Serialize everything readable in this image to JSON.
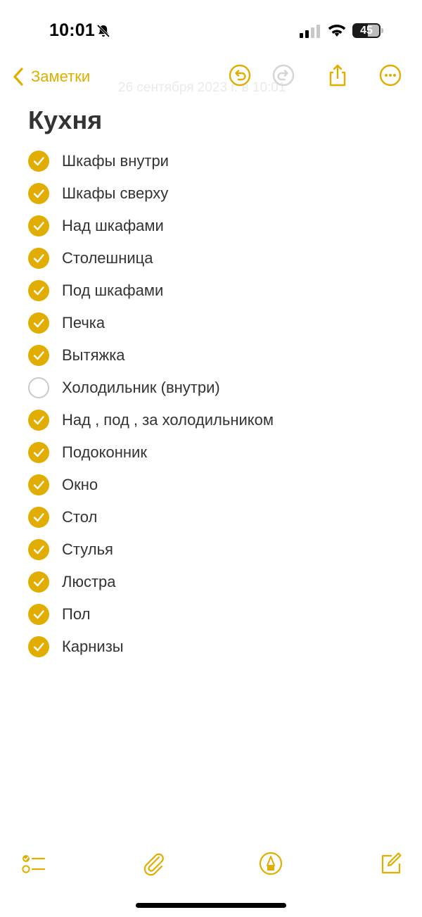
{
  "status_bar": {
    "time": "10:01",
    "battery": "45",
    "icons": [
      "bell-slash-icon",
      "cellular-signal-icon",
      "wifi-icon",
      "battery-icon"
    ]
  },
  "nav": {
    "back_label": "Заметки",
    "faded_date": "26 сентября 2023 г. в 10:01",
    "icons": [
      "chevron-left-icon",
      "undo-icon",
      "redo-icon",
      "share-icon",
      "more-icon"
    ]
  },
  "note": {
    "title": "Кухня",
    "items": [
      {
        "label": "Шкафы внутри",
        "checked": true
      },
      {
        "label": "Шкафы сверху",
        "checked": true
      },
      {
        "label": "Над шкафами",
        "checked": true
      },
      {
        "label": "Столешница",
        "checked": true
      },
      {
        "label": "Под шкафами",
        "checked": true
      },
      {
        "label": "Печка",
        "checked": true
      },
      {
        "label": "Вытяжка",
        "checked": true
      },
      {
        "label": "Холодильник (внутри)",
        "checked": false
      },
      {
        "label": "Над , под , за холодильником",
        "checked": true
      },
      {
        "label": "Подоконник",
        "checked": true
      },
      {
        "label": "Окно",
        "checked": true
      },
      {
        "label": "Стол",
        "checked": true
      },
      {
        "label": "Стулья",
        "checked": true
      },
      {
        "label": "Люстра",
        "checked": true
      },
      {
        "label": "Пол",
        "checked": true
      },
      {
        "label": "Карнизы",
        "checked": true
      }
    ]
  },
  "toolbar": {
    "icons": [
      "checklist-icon",
      "paperclip-icon",
      "markup-pen-icon",
      "compose-icon"
    ]
  },
  "colors": {
    "accent": "#e1ad01",
    "text": "#333333",
    "unchecked_border": "#c9c9c9"
  }
}
